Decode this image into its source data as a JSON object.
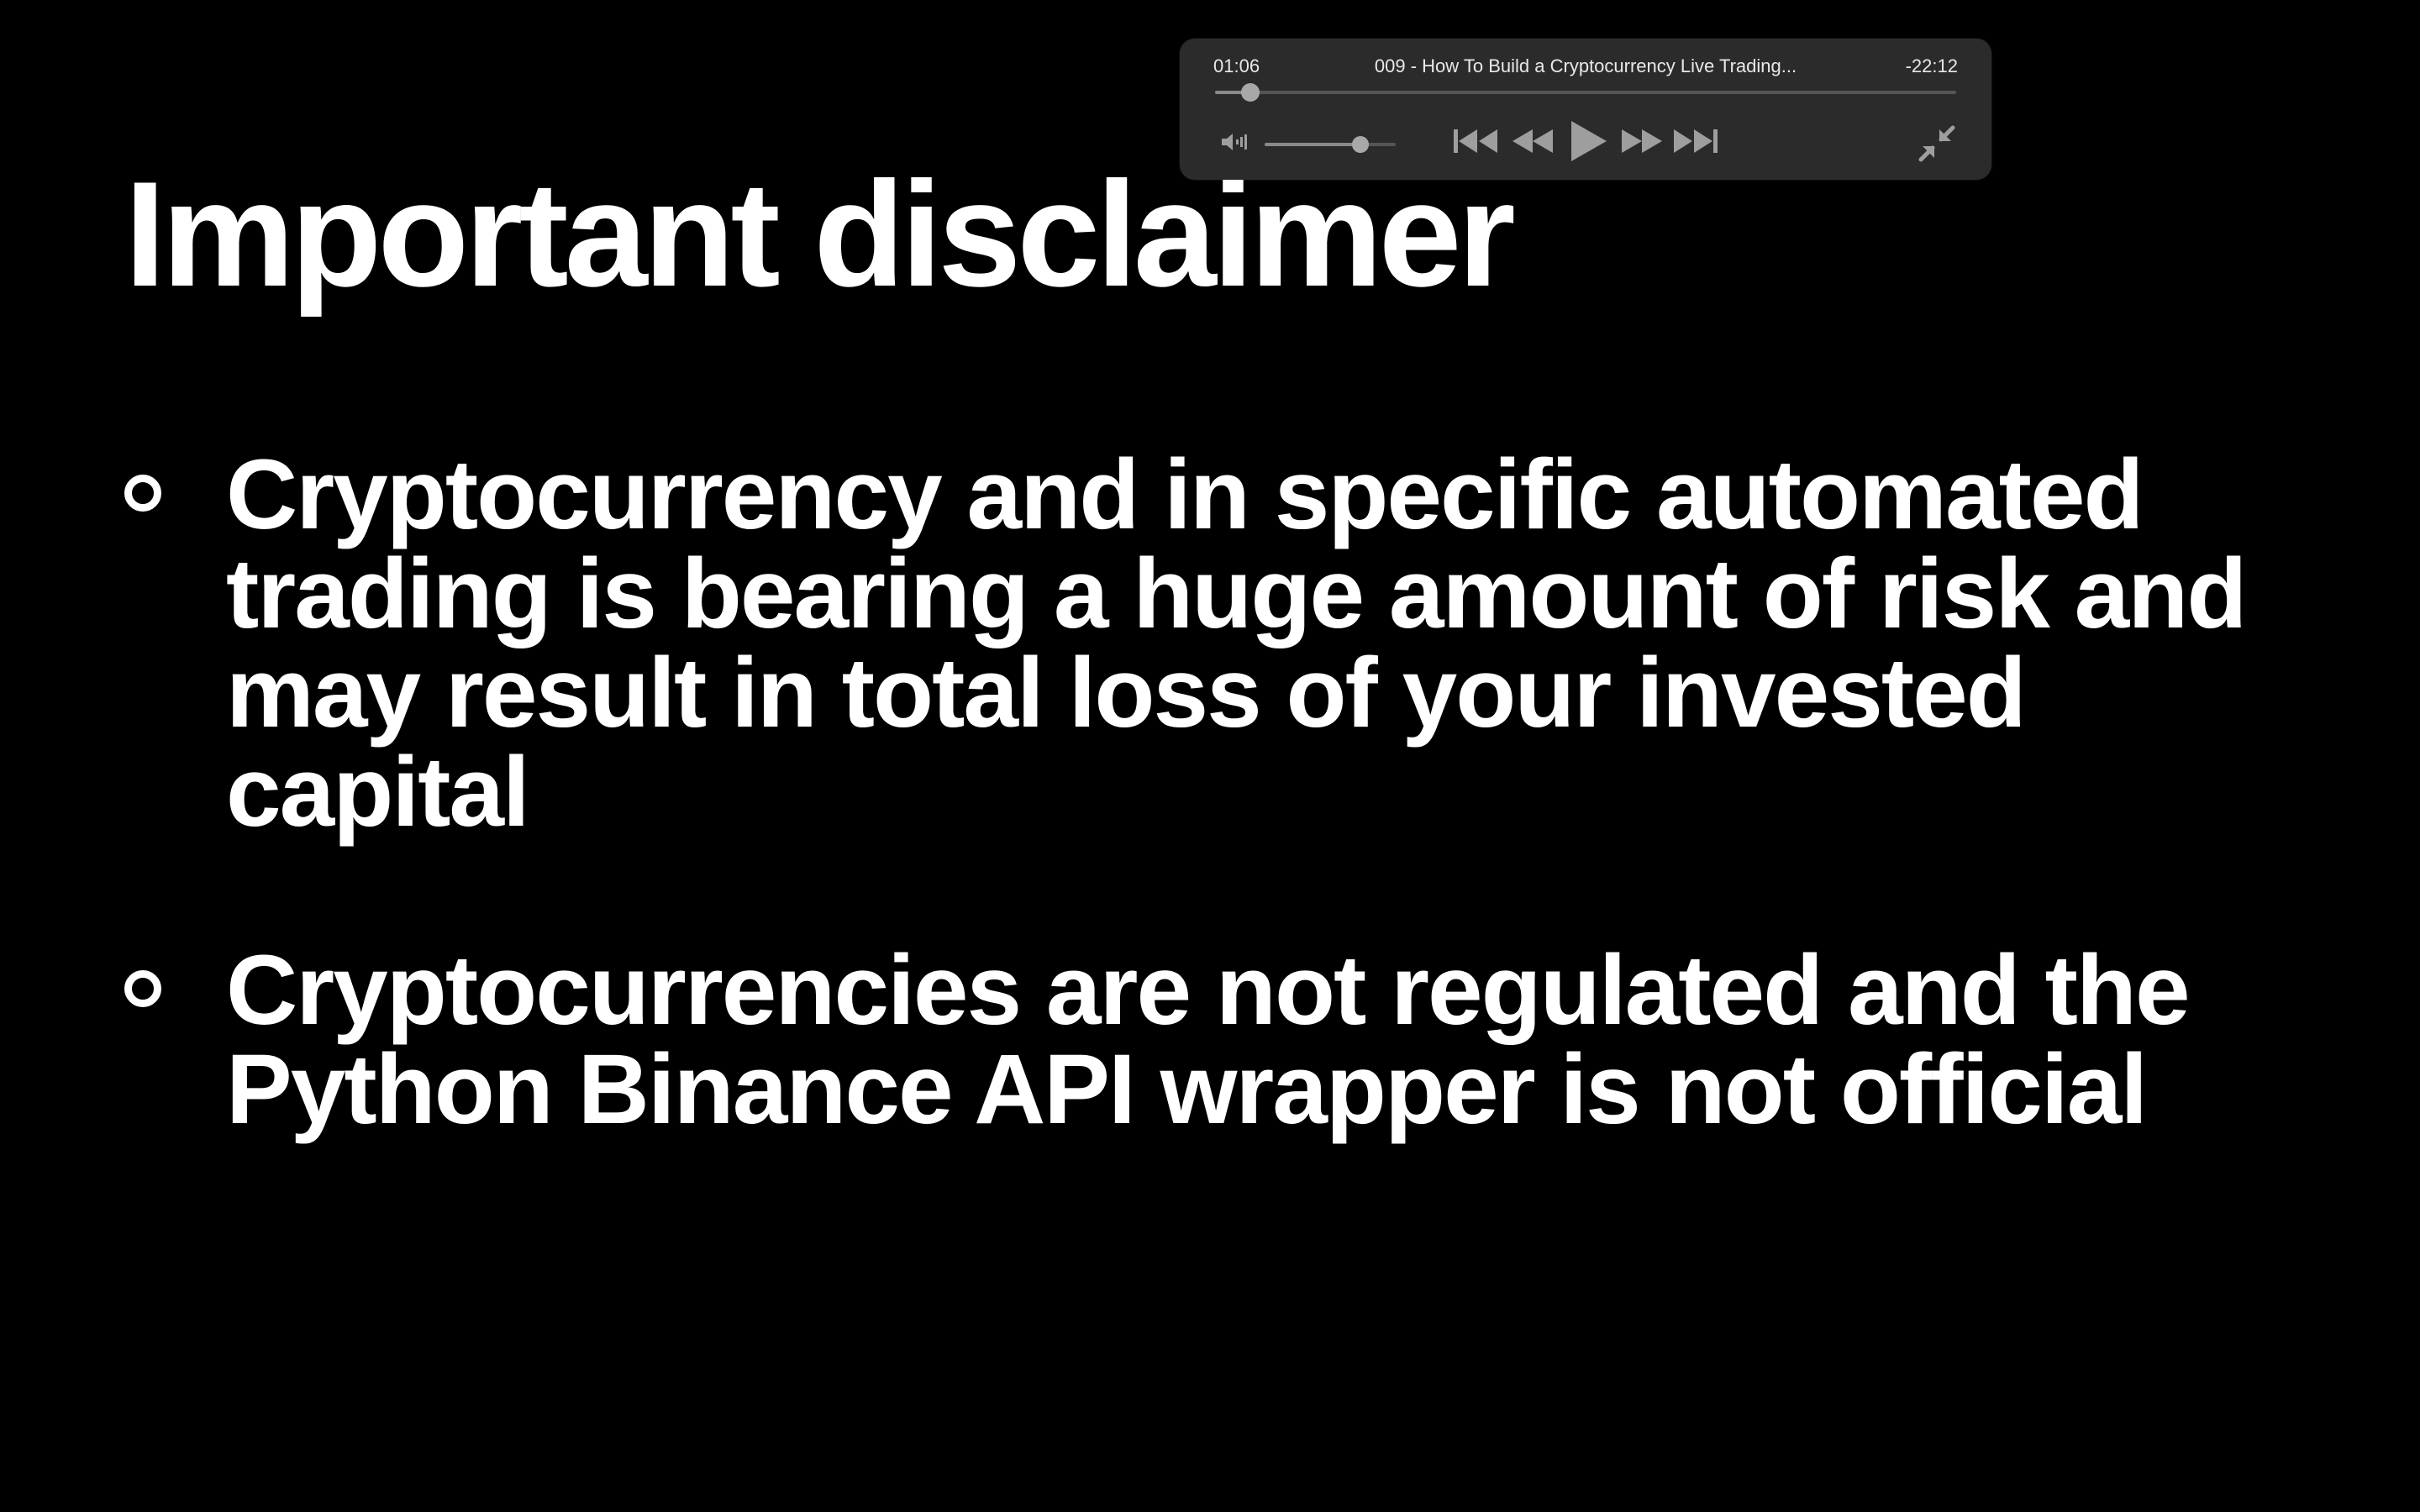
{
  "slide": {
    "title": "Important disclaimer",
    "bullets": [
      "Cryptocurrency and in specific automated trading is bearing a huge amount of risk and may result in total loss of your invested capital",
      "Cryptocurrencies are not regulated and the Python Binance API wrapper is not official"
    ]
  },
  "player": {
    "elapsed": "01:06",
    "title": "009 - How To Build a Cryptocurrency Live Trading...",
    "remaining": "-22:12",
    "progress_fraction": 0.0475,
    "volume_fraction": 0.73,
    "icons": [
      "volume-icon",
      "skip-back-icon",
      "rewind-icon",
      "play-icon",
      "fast-forward-icon",
      "skip-forward-icon",
      "minimize-icon"
    ],
    "colors": {
      "panel": "#2b2b2b",
      "icon": "#9e9e9e",
      "text": "#e8e8e8"
    }
  },
  "colors": {
    "background": "#000000",
    "text": "#ffffff"
  }
}
